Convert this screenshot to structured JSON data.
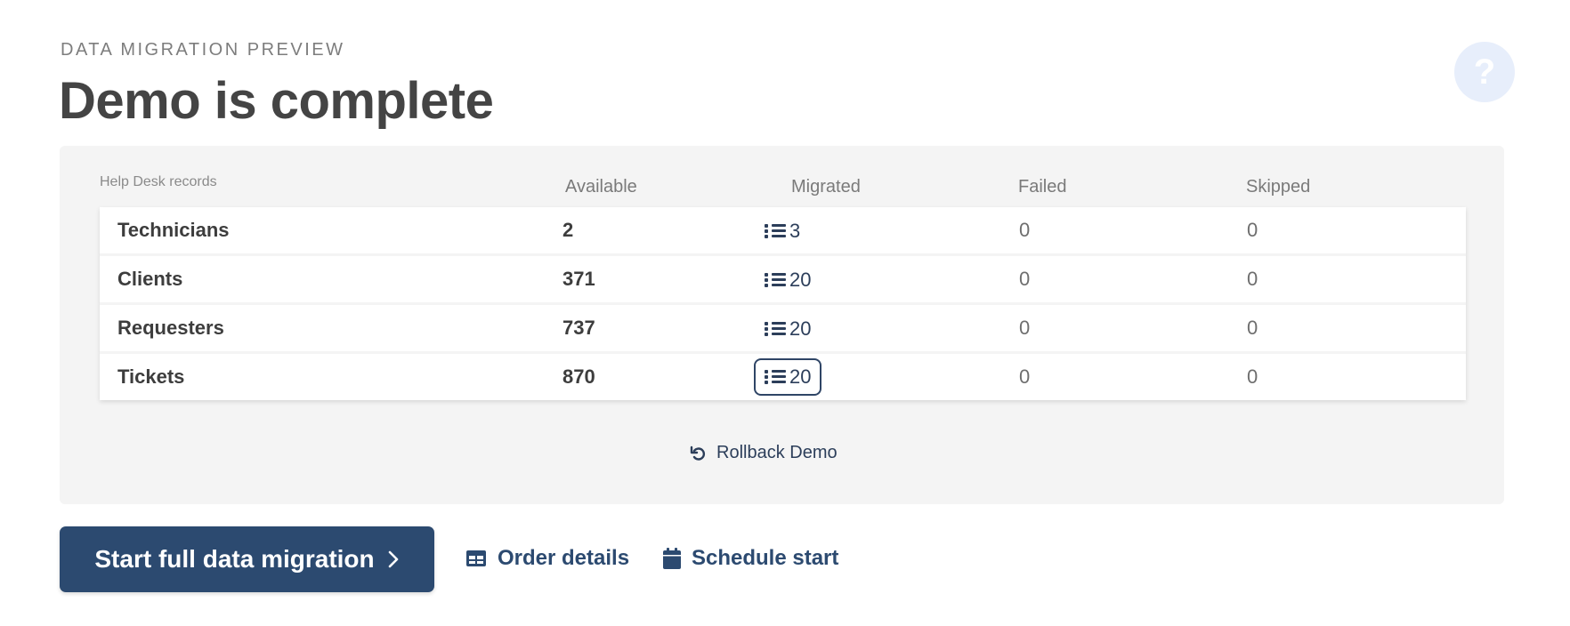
{
  "header": {
    "eyebrow": "DATA MIGRATION PREVIEW",
    "title": "Demo is complete",
    "help_glyph": "?"
  },
  "table": {
    "columns": {
      "records": "Help Desk records",
      "available": "Available",
      "migrated": "Migrated",
      "failed": "Failed",
      "skipped": "Skipped"
    },
    "rows": [
      {
        "name": "Technicians",
        "available": "2",
        "migrated": "3",
        "failed": "0",
        "skipped": "0"
      },
      {
        "name": "Clients",
        "available": "371",
        "migrated": "20",
        "failed": "0",
        "skipped": "0"
      },
      {
        "name": "Requesters",
        "available": "737",
        "migrated": "20",
        "failed": "0",
        "skipped": "0"
      },
      {
        "name": "Tickets",
        "available": "870",
        "migrated": "20",
        "failed": "0",
        "skipped": "0"
      }
    ]
  },
  "rollback_label": "Rollback Demo",
  "footer": {
    "primary_label": "Start full data migration",
    "order_label": "Order details",
    "schedule_label": "Schedule start"
  },
  "icons": {
    "help": "question-mark-icon",
    "list": "list-icon",
    "rollback": "undo-icon",
    "chevron": "chevron-right-icon",
    "table": "table-icon",
    "calendar": "calendar-icon"
  },
  "colors": {
    "primary": "#2c4a70",
    "link": "#2c3e5a",
    "panel_bg": "#f4f4f4",
    "help_bg": "#e7eefb"
  }
}
